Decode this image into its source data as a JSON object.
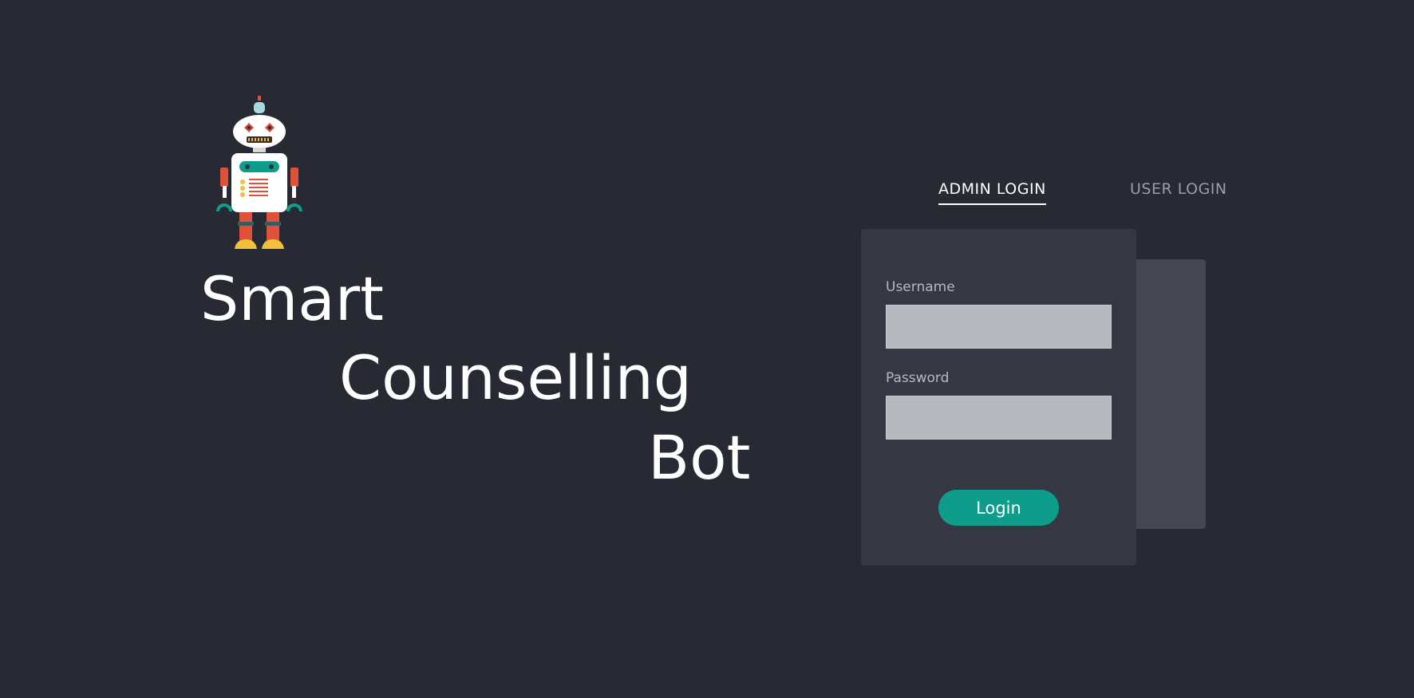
{
  "branding": {
    "title_line1": "Smart",
    "title_line2": "Counselling",
    "title_line3": "Bot",
    "logo_icon": "robot-icon"
  },
  "tabs": [
    {
      "label": "ADMIN LOGIN",
      "active": true
    },
    {
      "label": "USER LOGIN",
      "active": false
    }
  ],
  "login_form": {
    "username_label": "Username",
    "username_value": "",
    "password_label": "Password",
    "password_value": "",
    "submit_label": "Login"
  },
  "colors": {
    "background": "#272933",
    "card": "#353742",
    "back_card": "#444651",
    "accent": "#0f9d8b",
    "input": "#b5b9be"
  }
}
